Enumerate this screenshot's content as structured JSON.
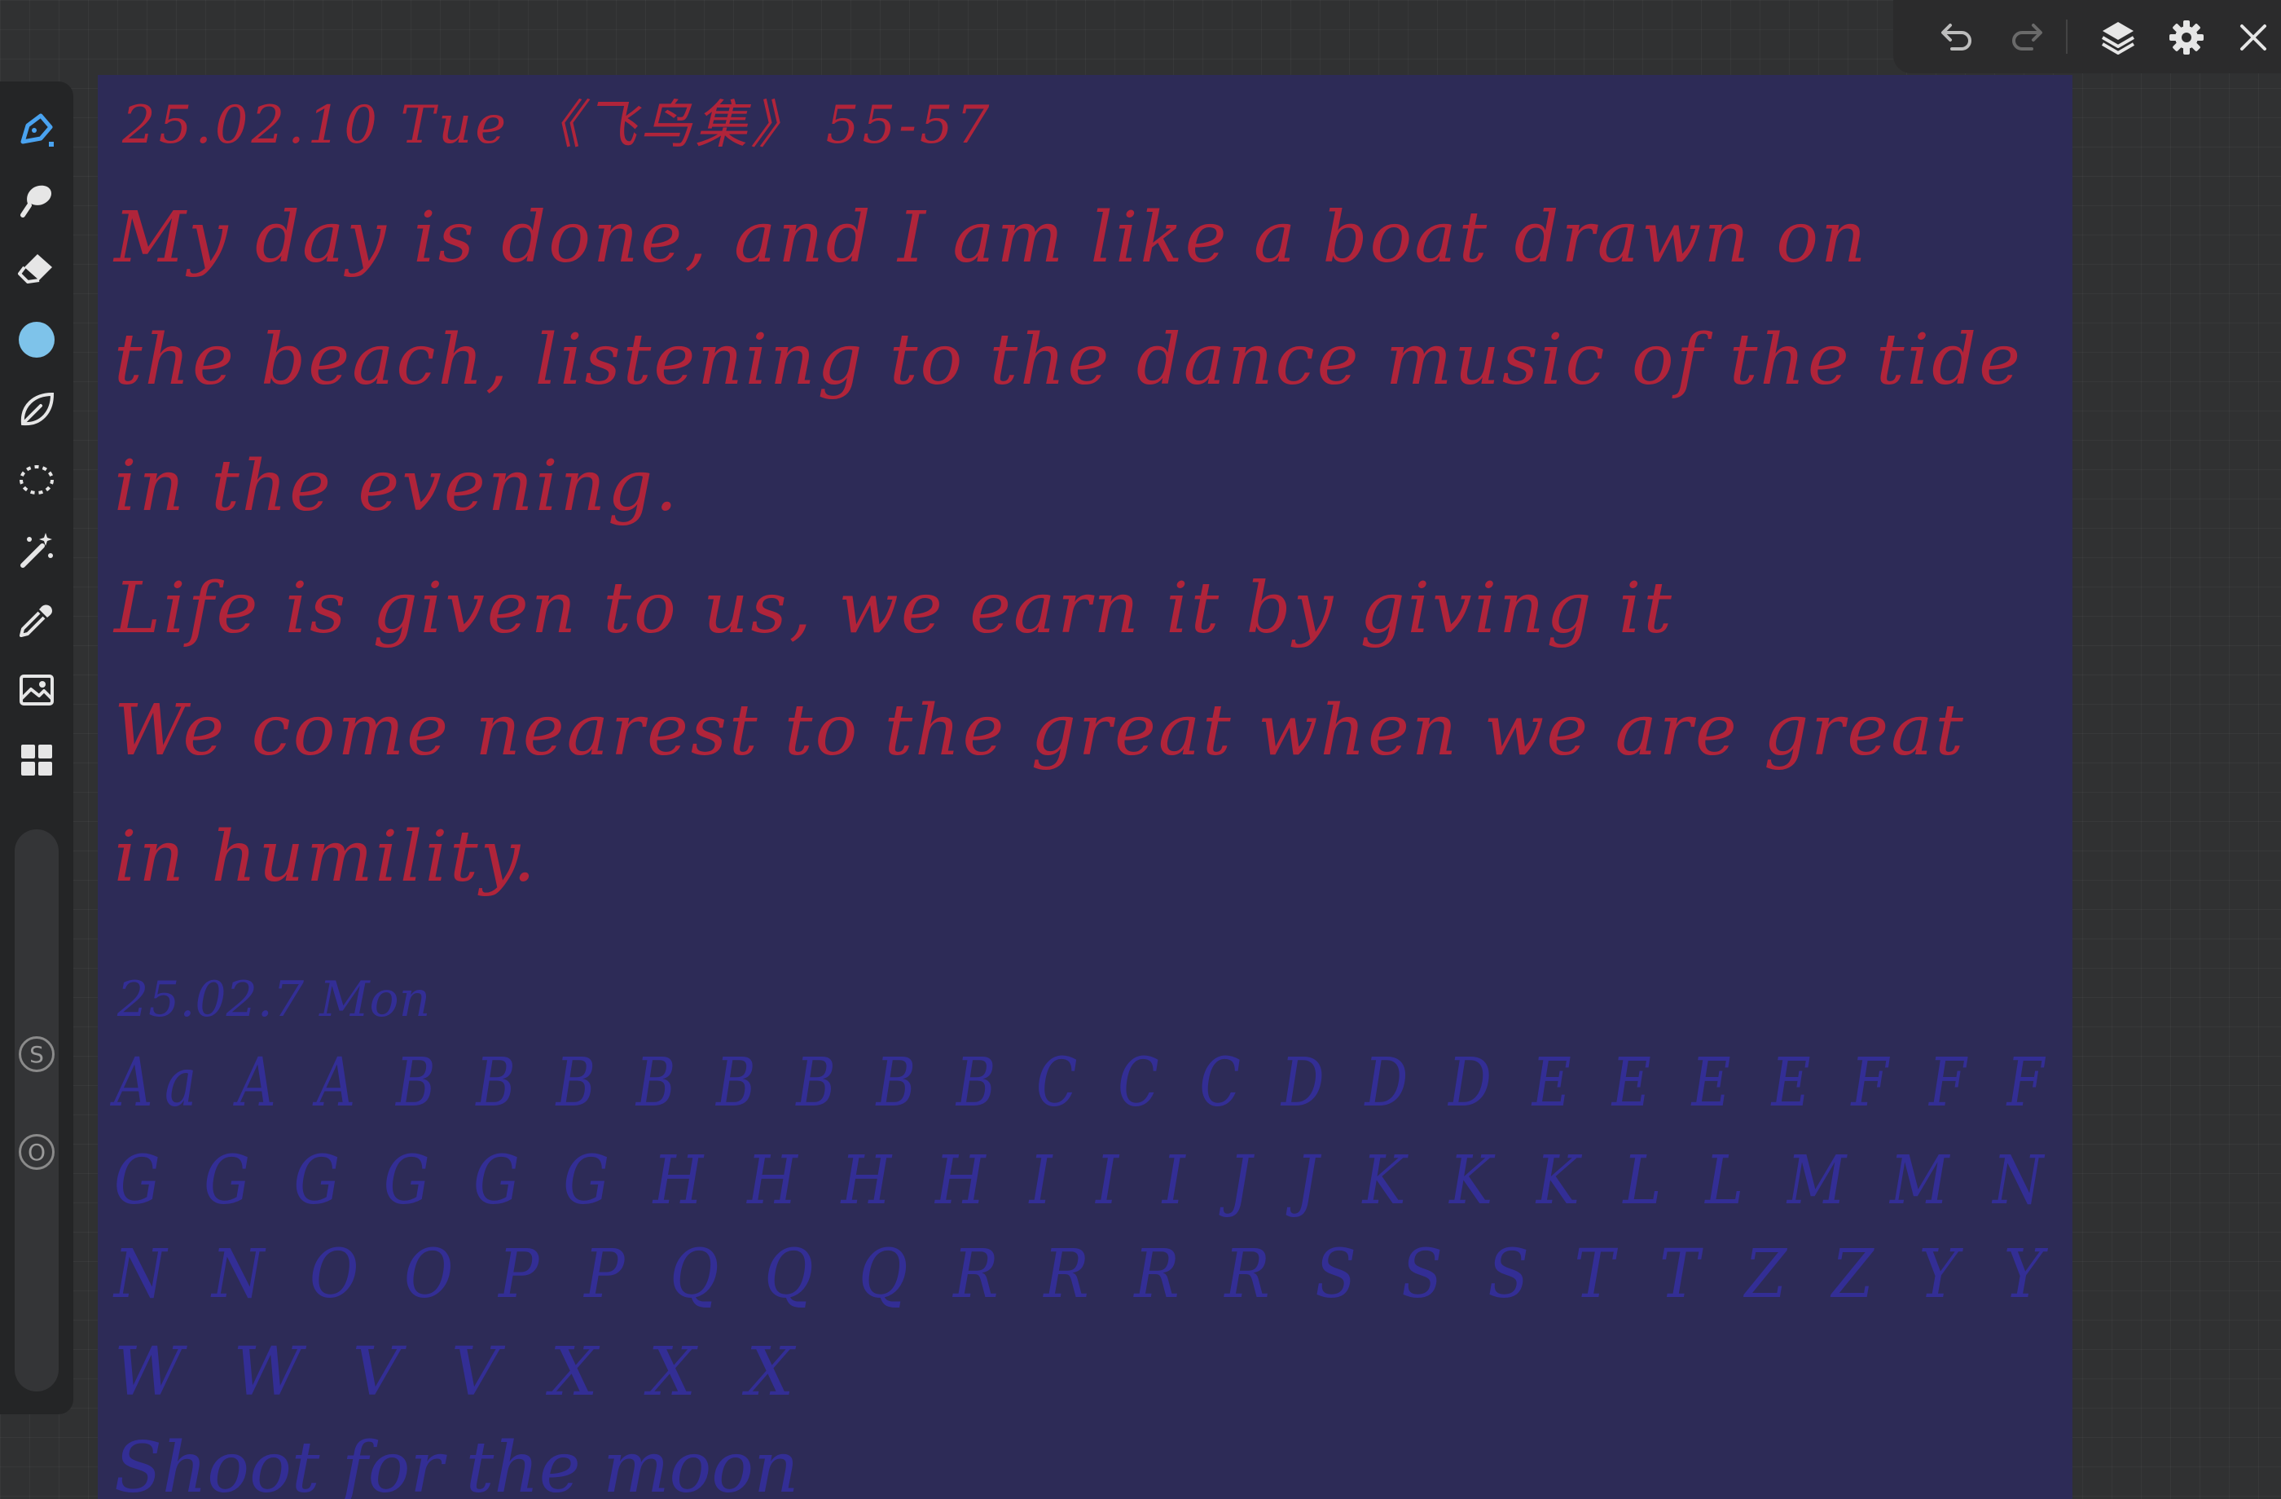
{
  "toolbar": {
    "undo_icon": "undo-icon",
    "redo_icon": "redo-icon",
    "layers_icon": "layers-icon",
    "settings_icon": "gear-icon",
    "close_icon": "close-icon"
  },
  "sidebar": {
    "tools": [
      {
        "name": "pen-tool",
        "icon": "pen-icon"
      },
      {
        "name": "smudge-tool",
        "icon": "smudge-icon"
      },
      {
        "name": "eraser-tool",
        "icon": "eraser-icon"
      },
      {
        "name": "color-picker",
        "icon": "color-swatch-icon",
        "color": "#7ec3ea"
      },
      {
        "name": "shape-tool",
        "icon": "leaf-icon"
      },
      {
        "name": "lasso-tool",
        "icon": "lasso-icon"
      },
      {
        "name": "magic-wand-tool",
        "icon": "magic-wand-icon"
      },
      {
        "name": "eyedropper-tool",
        "icon": "eyedropper-icon"
      },
      {
        "name": "image-import",
        "icon": "image-icon"
      },
      {
        "name": "gallery",
        "icon": "grid-icon"
      }
    ],
    "size_label": "S",
    "opacity_label": "O"
  },
  "canvas": {
    "paper_color": "#2d2b57",
    "ink_red": "#b0243a",
    "ink_blue": "#352fa0",
    "date_line": "25.02.10 Tue 《飞鸟集》 55-57",
    "lines": [
      "My day is done, and I am like a boat drawn on",
      "the beach, listening to the dance music of the tide",
      "in the evening.",
      "Life is given to us, we earn it by giving it",
      "We come nearest to the great when we are great",
      "in humility."
    ],
    "faint_date": "25.02.7 Mon",
    "faint_alphabet": [
      "Aa A A B B B B B B B B C C C D D D E E E E F F F",
      "G G G G G G H H H H I I I J J K K K L L M M N",
      "N N O O P P Q Q Q R R R R S S S T T Z Z Y Y",
      "W W V V X X X"
    ],
    "faint_footer": "Shoot for the moon"
  }
}
